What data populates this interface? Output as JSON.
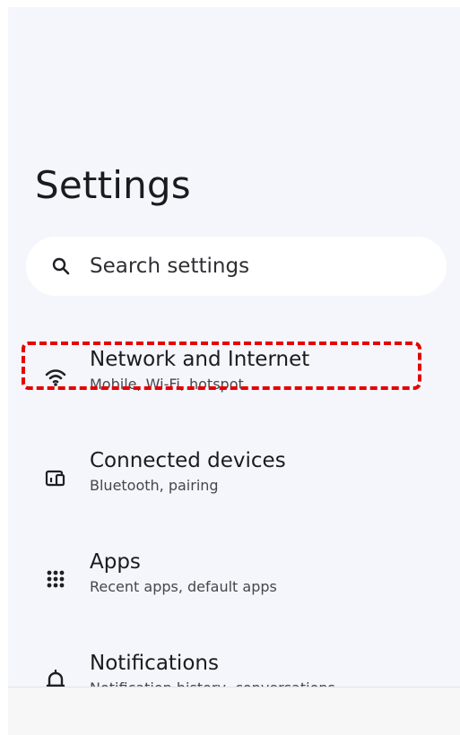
{
  "header": {
    "title": "Settings"
  },
  "search": {
    "placeholder": "Search settings",
    "icon": "search-icon"
  },
  "settings": {
    "items": [
      {
        "title": "Network and Internet",
        "subtitle": "Mobile, Wi-Fi, hotspot",
        "icon": "wifi-icon"
      },
      {
        "title": "Connected devices",
        "subtitle": "Bluetooth, pairing",
        "icon": "connected-devices-icon"
      },
      {
        "title": "Apps",
        "subtitle": "Recent apps, default apps",
        "icon": "apps-grid-icon"
      },
      {
        "title": "Notifications",
        "subtitle": "Notification history, conversations",
        "icon": "bell-icon"
      }
    ]
  },
  "theme": {
    "surface": "#f5f6fb",
    "highlight": "#e60000",
    "title_color": "#1b1b1f",
    "subtitle_color": "#46464d"
  }
}
